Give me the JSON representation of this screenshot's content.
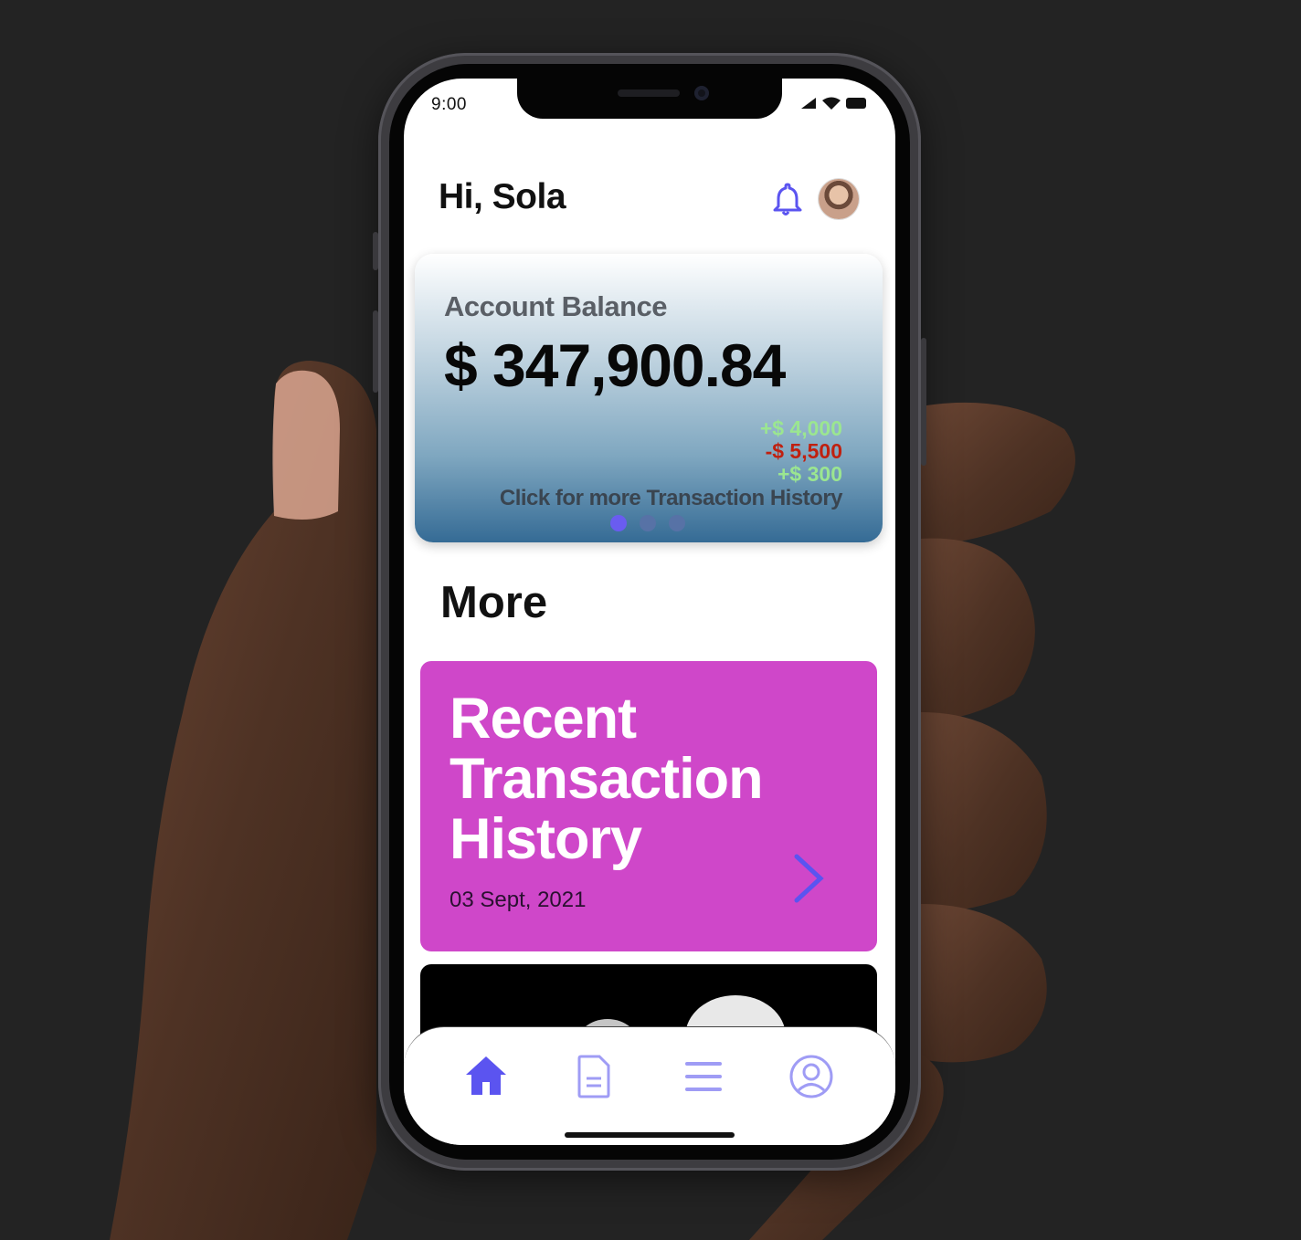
{
  "status_bar": {
    "time": "9:00"
  },
  "header": {
    "greeting": "Hi, Sola"
  },
  "balance_card": {
    "label": "Account Balance",
    "amount": "$ 347,900.84",
    "transactions": [
      "+$ 4,000",
      "-$ 5,500",
      "+$ 300"
    ],
    "link_text": "Click for more Transaction History",
    "page_count": 3,
    "active_page": 1
  },
  "more": {
    "title": "More"
  },
  "recent_card": {
    "title": "Recent Transaction History",
    "date": "03 Sept, 2021"
  },
  "tabbar": {
    "items": [
      "home-icon",
      "document-icon",
      "menu-icon",
      "profile-icon"
    ],
    "active": "home-icon"
  },
  "colors": {
    "accent": "#5b54f0",
    "recent_card": "#cf47c9",
    "positive": "#9be690",
    "negative": "#c0200f"
  }
}
